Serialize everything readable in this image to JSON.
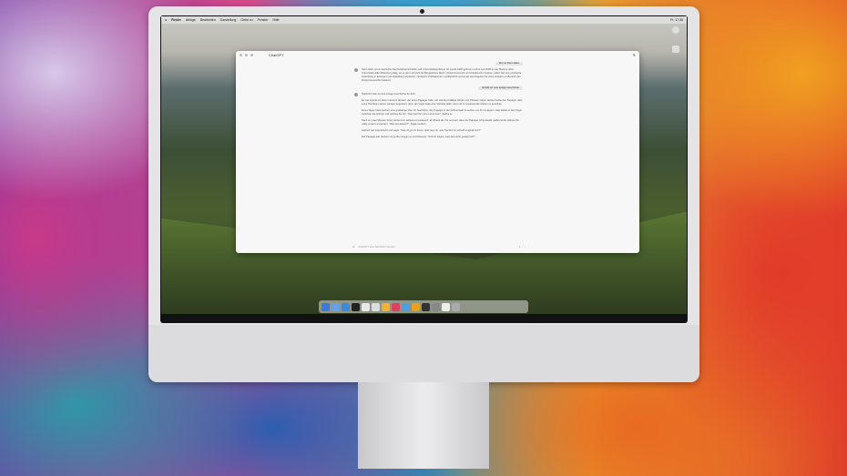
{
  "menubar": {
    "apple": "",
    "items": [
      "Finder",
      "Ablage",
      "Bearbeiten",
      "Darstellung",
      "Gehe zu",
      "Fenster",
      "Hilfe"
    ],
    "clock": "Fr. 17:36"
  },
  "window": {
    "title": "ChatGPT",
    "input_placeholder": "ChatGPT eine Nachricht senden"
  },
  "messages": [
    {
      "role": "user",
      "text": "Wer ist Karl Lüdert"
    },
    {
      "role": "assistant",
      "paragraphs": [
        "Karl Lüdert ist ein deutscher Rechtswissenschaftler und Universitätsprofessor. Er wurde 1966 geboren und ist seit 2008 an der Martin-Luther-Universität Halle-Wittenberg tätig, wo er den Lehrstuhl für Bürgerliches Recht, Zivilprozessrecht und Arbeitsrecht innehat. Lüdert hat eine juristische Ausbildung in Erlangen und Heidelberg absolviert, zahlreiche Publikationen veröffentlicht und ist als Herausgeber für seine Arbeiten im Bereich des Zivilprozessrechts bekannt."
      ]
    },
    {
      "role": "user",
      "text": "Erzähl mir eine lustige Geschichte"
    },
    {
      "role": "assistant",
      "paragraphs": [
        "Natürlich! Hier ist eine lustige Geschichte für dich:",
        "Es war einmal ein Mann namens Herbert, der einen Papagei hatte, der ständig zufällige Wörter und Phrasen sagte. Herbert liebte den Papagei, aber seine Nachbarn waren weniger begeistert, denn der Vogel hatte eine Vorliebe dafür, laut und zu unpassenden Zeiten zu sprechen.",
        "Eines Tages hatte Herbert eine großartige Idee. Er beschloss, den Papagei in den Hühnerstall zu setzen, um ihn zu ärgern. Also stellte er den Vogel zwischen die Hühner und schloss die Tür. \"Das wird ihm eine Lehre sein\", dachte er.",
        "Nach ein paar Minuten hörte Herbert ein seltsames Geräusch. Er öffnete die Tür und sah, dass der Papagei ruhig dasaß, während die Hühner ihn völlig verwirrt anstarrten. \"Was ist passiert?\", fragte Herbert.",
        "Herbert war beeindruckt und sagte: \"Das ist gut zu hören, aber sag mir, was hat dich so schnell umgestimmt?\"",
        "Der Papagei sah Herbert mit großen Augen an und flüsterte: \"Soll ich fragen, was das Huhn gesagt hat?\""
      ]
    }
  ]
}
